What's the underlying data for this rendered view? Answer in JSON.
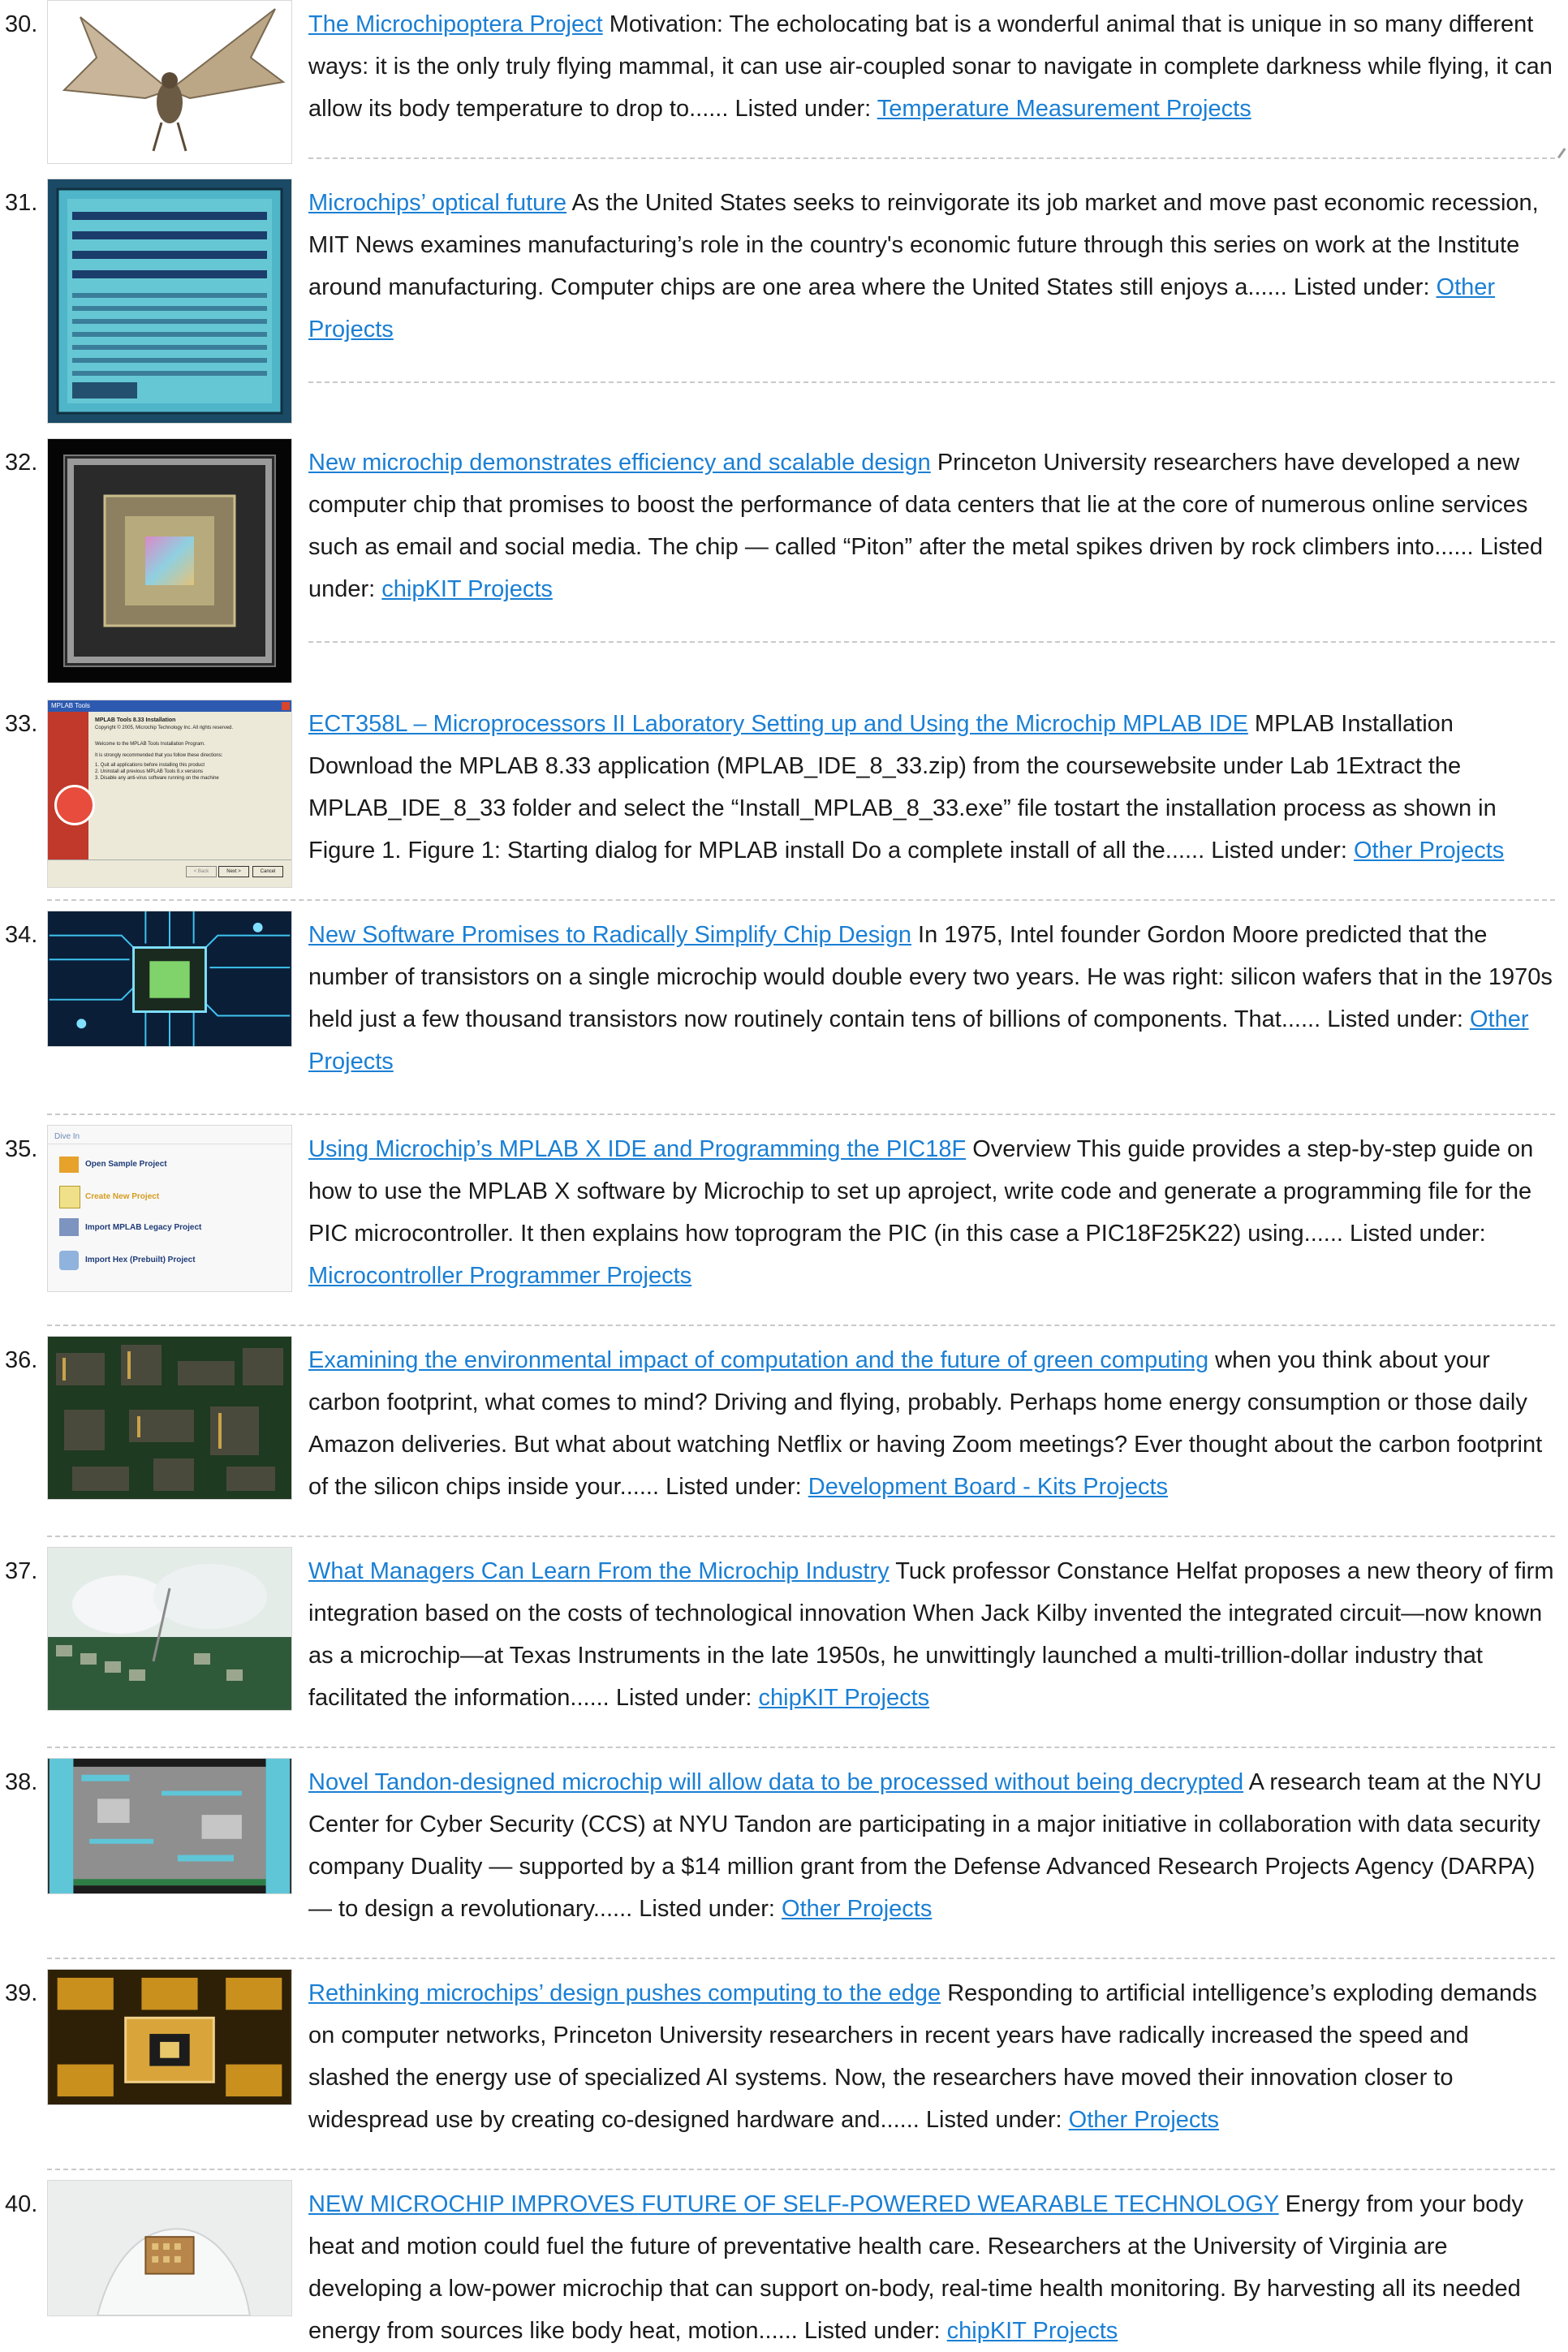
{
  "items": [
    {
      "num": "30.",
      "title": "The Microchipoptera Project",
      "desc": "Motivation:     The echolocating bat is a wonderful animal that is unique in so many different ways:  it is the only truly flying mammal, it can use air-coupled sonar to navigate in complete darkness while flying, it can allow its body temperature to drop to......",
      "listed": "Listed under:",
      "category": "Temperature Measurement Projects"
    },
    {
      "num": "31.",
      "title": "Microchips’ optical future",
      "desc": "As the United States seeks to reinvigorate its job market and move past economic recession, MIT News examines manufacturing’s role in the country's economic future through this series on work at the Institute around manufacturing. Computer chips are one area where the United States still enjoys a......",
      "listed": "Listed under:",
      "category": "Other Projects"
    },
    {
      "num": "32.",
      "title": "New microchip demonstrates efficiency and scalable design",
      "desc": "Princeton University researchers have developed a new computer chip that promises to boost the performance of data centers that lie at the core of numerous online services such as email and social media. The chip — called “Piton” after the metal spikes driven by rock climbers into......",
      "listed": "Listed under:",
      "category": "chipKIT Projects"
    },
    {
      "num": "33.",
      "title": "ECT358L – Microprocessors II Laboratory Setting up and Using the Microchip MPLAB IDE",
      "desc": "MPLAB Installation Download the MPLAB 8.33 application (MPLAB_IDE_8_33.zip) from the coursewebsite under Lab 1Extract the MPLAB_IDE_8_33 folder and select the “Install_MPLAB_8_33.exe” file tostart the installation process as shown in Figure 1. Figure 1: Starting dialog for MPLAB install Do a complete install of all the......",
      "listed": "Listed under:",
      "category": "Other Projects"
    },
    {
      "num": "34.",
      "title": "New Software Promises to Radically Simplify Chip Design",
      "desc": "In 1975, Intel founder Gordon Moore predicted that the number of transistors on a single microchip would double every two years. He was right: silicon wafers that in the 1970s held just a few thousand transistors now routinely contain tens of billions of components. That......",
      "listed": "Listed under:",
      "category": "Other Projects"
    },
    {
      "num": "35.",
      "title": "Using Microchip’s MPLAB X IDE and Programming the PIC18F",
      "desc": "Overview This guide provides a step-by-step guide on how to use the MPLAB X software by Microchip to set up aproject, write code and generate a programming file for the PIC microcontroller. It then explains how toprogram the PIC (in this case a PIC18F25K22) using......",
      "listed": "Listed under:",
      "category": "Microcontroller Programmer Projects"
    },
    {
      "num": "36.",
      "title": "Examining the environmental impact of computation and the future of green computing",
      "desc": "when you think about your carbon footprint, what comes to mind? Driving and flying, probably. Perhaps home energy consumption or those daily Amazon deliveries. But what about watching Netflix or having Zoom meetings? Ever thought about the carbon footprint of the silicon chips inside your......",
      "listed": "Listed under:",
      "category": "Development Board - Kits Projects"
    },
    {
      "num": "37.",
      "title": "What Managers Can Learn From the Microchip Industry",
      "desc": "Tuck professor Constance Helfat proposes a new theory of firm integration based on the costs of technological innovation When Jack Kilby invented the integrated circuit—now known as a microchip—at Texas Instruments in the late 1950s, he unwittingly launched a multi-trillion-dollar industry that facilitated the information......",
      "listed": "Listed under:",
      "category": "chipKIT Projects"
    },
    {
      "num": "38.",
      "title": "Novel Tandon-designed microchip will allow data to be processed without being decrypted",
      "desc": "A research team at the NYU Center for Cyber Security (CCS) at NYU Tandon are participating in a major initiative in collaboration with data security company Duality — supported by a $14 million grant from the Defense Advanced Research Projects Agency (DARPA) — to design a revolutionary......",
      "listed": "Listed under:",
      "category": "Other Projects"
    },
    {
      "num": "39.",
      "title": "Rethinking microchips’ design pushes computing to the edge",
      "desc": "Responding to artificial intelligence’s exploding demands on computer networks, Princeton University researchers in recent years have radically increased the speed and slashed the energy use of specialized AI systems. Now, the researchers have moved their innovation closer to widespread use by creating co-designed hardware and......",
      "listed": "Listed under:",
      "category": "Other Projects"
    },
    {
      "num": "40.",
      "title": "NEW MICROCHIP IMPROVES FUTURE OF SELF-POWERED WEARABLE TECHNOLOGY",
      "desc": "Energy from your body heat and motion could fuel the future of preventative health care. Researchers at the University of Virginia are developing a low-power microchip that can support on-body, real-time health monitoring. By harvesting all its needed energy from sources like body heat, motion......",
      "listed": "Listed under:",
      "category": "chipKIT Projects"
    }
  ],
  "thumbnails": {
    "33": {
      "dialog_title": "MPLAB Tools",
      "heading": "MPLAB Tools 8.33 Installation",
      "copyright": "Copyright © 2005, Microchip Technology Inc. All rights reserved.",
      "welcome": "Welcome to the MPLAB Tools Installation Program.",
      "recommend": "It is strongly recommended that you follow these directions:",
      "step1": "1. Quit all applications before installing this product",
      "step2": "2. Uninstall all previous MPLAB Tools 8.x versions",
      "step3": "3. Disable any anti-virus software running on the machine",
      "back": "< Back",
      "next": "Next >",
      "cancel": "Cancel"
    },
    "35": {
      "header": "Dive In",
      "opt1": "Open Sample Project",
      "opt2": "Create New Project",
      "opt3": "Import MPLAB Legacy Project",
      "opt4": "Import Hex (Prebuilt) Project"
    }
  },
  "colors": {
    "link": "#1a7fd4",
    "text": "#1a1a1a",
    "separator": "#c9c9c9"
  }
}
